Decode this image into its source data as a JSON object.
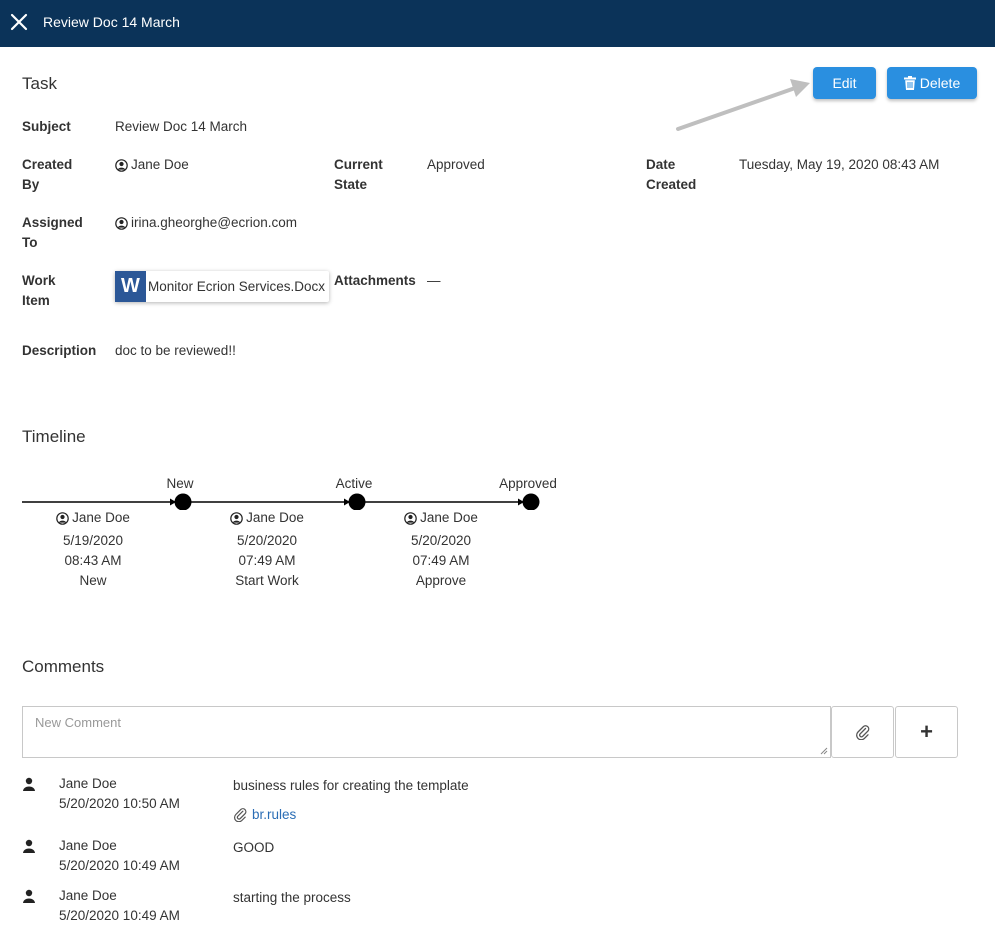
{
  "header": {
    "title": "Review Doc 14 March",
    "close_icon": "close-icon"
  },
  "task": {
    "section_title": "Task",
    "edit_label": "Edit",
    "delete_label": "Delete",
    "subject_label": "Subject",
    "subject_value": "Review Doc 14 March",
    "created_by_label_1": "Created",
    "created_by_label_2": "By",
    "created_by_value": "Jane Doe",
    "current_state_label_1": "Current",
    "current_state_label_2": "State",
    "current_state_value": "Approved",
    "date_created_label_1": "Date",
    "date_created_label_2": "Created",
    "date_created_value": "Tuesday, May 19, 2020 08:43 AM",
    "assigned_to_label_1": "Assigned",
    "assigned_to_label_2": "To",
    "assigned_to_value": "irina.gheorghe@ecrion.com",
    "work_item_label_1": "Work",
    "work_item_label_2": "Item",
    "work_item_icon_letter": "W",
    "work_item_value": "Monitor Ecrion Services.Docx",
    "attachments_label": "Attachments",
    "attachments_value": "—",
    "description_label": "Description",
    "description_value": "doc to be reviewed!!"
  },
  "timeline": {
    "section_title": "Timeline",
    "states": [
      "New",
      "Active",
      "Approved"
    ],
    "entries": [
      {
        "user": "Jane Doe",
        "date": "5/19/2020",
        "time": "08:43 AM",
        "action": "New"
      },
      {
        "user": "Jane Doe",
        "date": "5/20/2020",
        "time": "07:49 AM",
        "action": "Start Work"
      },
      {
        "user": "Jane Doe",
        "date": "5/20/2020",
        "time": "07:49 AM",
        "action": "Approve"
      }
    ]
  },
  "comments": {
    "section_title": "Comments",
    "placeholder": "New Comment",
    "add_label": "+",
    "items": [
      {
        "user": "Jane Doe",
        "timestamp": "5/20/2020 10:50 AM",
        "text": "business rules for creating the template",
        "attachment": "br.rules"
      },
      {
        "user": "Jane Doe",
        "timestamp": "5/20/2020 10:49 AM",
        "text": "GOOD"
      },
      {
        "user": "Jane Doe",
        "timestamp": "5/20/2020 10:49 AM",
        "text": "starting the process"
      }
    ]
  },
  "colors": {
    "header_bg": "#0b3359",
    "button_primary": "#2a8fe0",
    "link": "#2a6db5",
    "word_icon": "#2b5797"
  }
}
